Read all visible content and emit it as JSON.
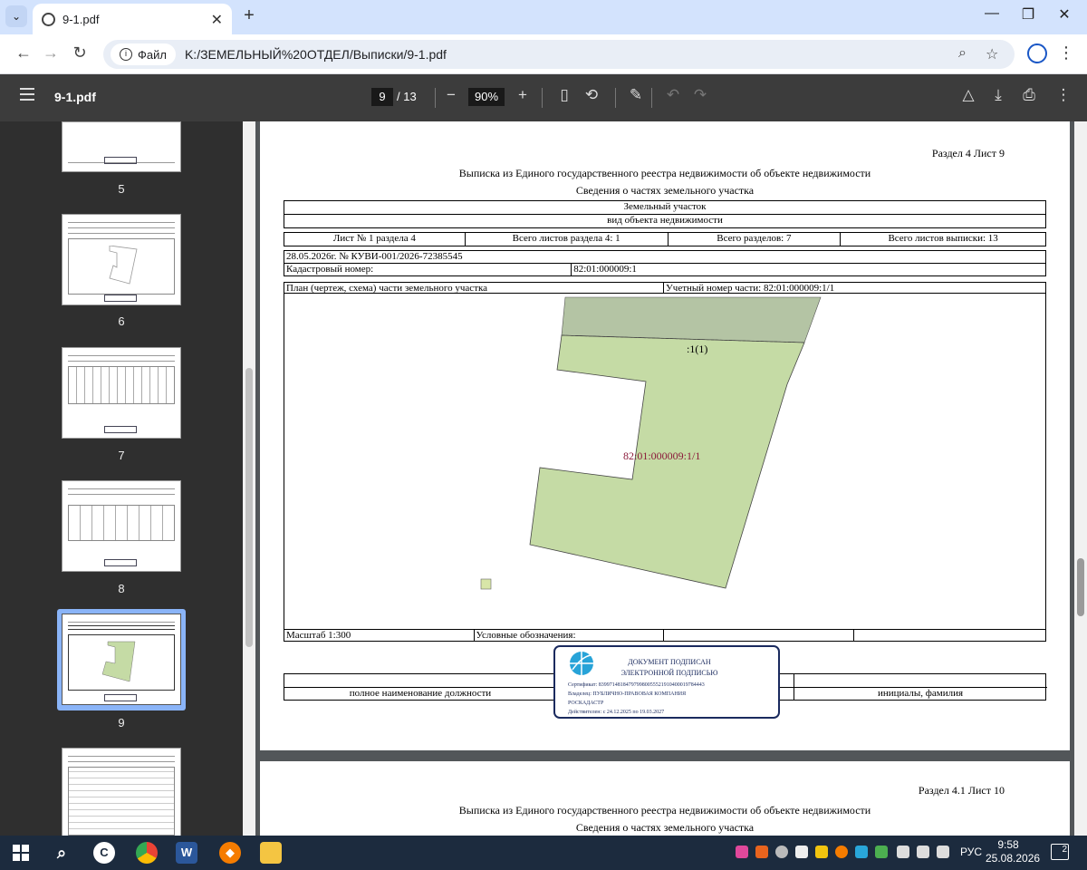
{
  "browser": {
    "tab_title": "9-1.pdf",
    "address_chip": "Файл",
    "url": "K:/ЗЕМЕЛЬНЫЙ%20ОТДЕЛ/Выписки/9-1.pdf"
  },
  "pdf_toolbar": {
    "file_name": "9-1.pdf",
    "current_page": "9",
    "total_pages": "/ 13",
    "zoom": "90%"
  },
  "thumbnails": [
    {
      "label": "5"
    },
    {
      "label": "6"
    },
    {
      "label": "7"
    },
    {
      "label": "8"
    },
    {
      "label": "9"
    }
  ],
  "page9": {
    "section": "Раздел 4    Лист 9",
    "title": "Выписка из Единого государственного реестра недвижимости об объекте недвижимости",
    "subtitle": "Сведения о частях земельного участка",
    "object": "Земельный участок",
    "object_type": "вид объекта недвижимости",
    "sheet_cells": [
      "Лист № 1 раздела 4",
      "Всего листов раздела 4: 1",
      "Всего разделов: 7",
      "Всего листов выписки: 13"
    ],
    "date_number": "28.05.2026г. № КУВИ-001/2026-72385545",
    "cadastral_label": "Кадастровый номер:",
    "cadastral_value": "82:01:000009:1",
    "plan_label": "План (чертеж, схема) части земельного участка",
    "part_number": "Учетный номер части: 82:01:000009:1/1",
    "label_part": ":1(1)",
    "label_parcel": "82:01:000009:1/1",
    "scale": "Масштаб 1:300",
    "legend": "Условные обозначения:",
    "position_label": "полное наименование должности",
    "name_label": "инициалы, фамилия",
    "stamp": {
      "line1": "ДОКУМЕНТ ПОДПИСАН",
      "line2": "ЭЛЕКТРОННОЙ ПОДПИСЬЮ",
      "cert": "Сертификат: 839971481847979980055521910400019784443",
      "owner": "Владелец: ПУБЛИЧНО-ПРАВОВАЯ КОМПАНИЯ",
      "owner2": "РОСКАДАСТР",
      "valid": "Действителен: с 24.12.2025 по 19.03.2027"
    }
  },
  "page10": {
    "section": "Раздел 4.1 Лист 10",
    "title": "Выписка из Единого государственного реестра недвижимости об объекте недвижимости",
    "subtitle": "Сведения о частях земельного участка"
  },
  "taskbar": {
    "lang": "РУС",
    "time": "9:58",
    "date": "25.08.2026",
    "notif_count": "2"
  }
}
